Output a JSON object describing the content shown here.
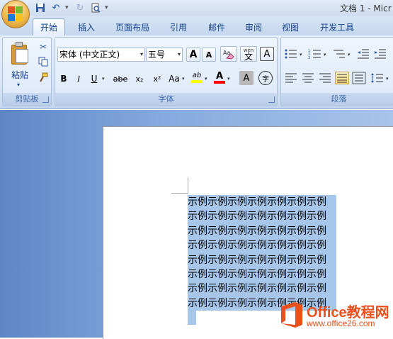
{
  "window": {
    "title": "文档 1 - Micr"
  },
  "quick_access": {
    "save_icon": "save-icon",
    "undo_icon": "undo-icon",
    "redo_icon": "redo-icon",
    "print_preview_icon": "print-preview-icon"
  },
  "tabs": [
    {
      "label": "开始",
      "active": true
    },
    {
      "label": "插入"
    },
    {
      "label": "页面布局"
    },
    {
      "label": "引用"
    },
    {
      "label": "邮件"
    },
    {
      "label": "审阅"
    },
    {
      "label": "视图"
    },
    {
      "label": "开发工具"
    }
  ],
  "ribbon": {
    "clipboard": {
      "label": "剪贴板",
      "paste_label": "粘贴"
    },
    "font": {
      "label": "字体",
      "font_name": "宋体 (中文正文)",
      "font_size": "五号",
      "grow": "A",
      "shrink": "A",
      "clear_format": "Aa",
      "pinyin": "wén",
      "pinyin_char": "文",
      "border_char": "A",
      "bold": "B",
      "italic": "I",
      "underline": "U",
      "strike": "abe",
      "subscript": "x₂",
      "superscript": "x²",
      "change_case": "Aa",
      "highlight": "ab",
      "font_color": "A",
      "shading_char": "A",
      "enclose_char": "字",
      "highlight_color": "#ffff00",
      "font_color_value": "#ff0000"
    },
    "paragraph": {
      "label": "段落"
    }
  },
  "document": {
    "lines": [
      "示例示例示例示例示例示例示例",
      "示例示例示例示例示例示例示例",
      "示例示例示例示例示例示例示例",
      "示例示例示例示例示例示例示例",
      "示例示例示例示例示例示例示例",
      "示例示例示例示例示例示例示例",
      "示例示例示例示例示例示例示例",
      "示例示例示例示例示例示例示例"
    ],
    "selection_color": "#a6c6ea"
  },
  "watermark": {
    "title": "Office教程网",
    "url": "www.office26.com"
  }
}
